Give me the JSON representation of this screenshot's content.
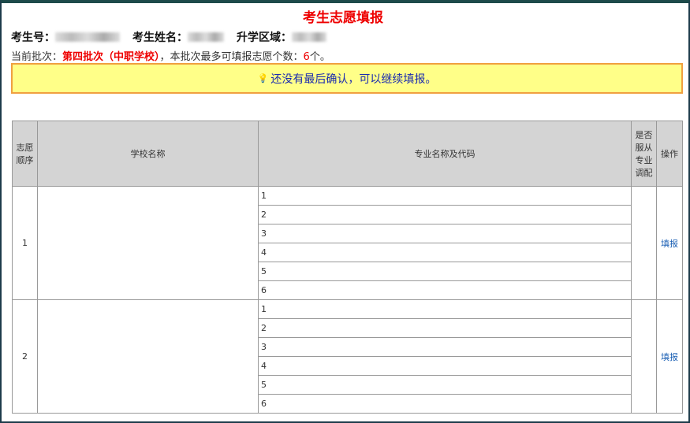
{
  "title": "考生志愿填报",
  "info": {
    "exam_no_label": "考生号：",
    "name_label": "考生姓名：",
    "region_label": "升学区域："
  },
  "batch": {
    "label": "当前批次：",
    "name": "第四批次（中职学校）",
    "mid": "，本批次最多可填报志愿个数：",
    "count": "6",
    "suffix": "个。"
  },
  "notice": "还没有最后确认，可以继续填报。",
  "table": {
    "headers": [
      "志愿顺序",
      "学校名称",
      "专业名称及代码",
      "是否服从专业调配",
      "操作"
    ],
    "groups": [
      {
        "order": "1",
        "majors": [
          "1",
          "2",
          "3",
          "4",
          "5",
          "6"
        ],
        "action": "填报"
      },
      {
        "order": "2",
        "majors": [
          "1",
          "2",
          "3",
          "4",
          "5",
          "6"
        ],
        "action": "填报"
      }
    ]
  }
}
